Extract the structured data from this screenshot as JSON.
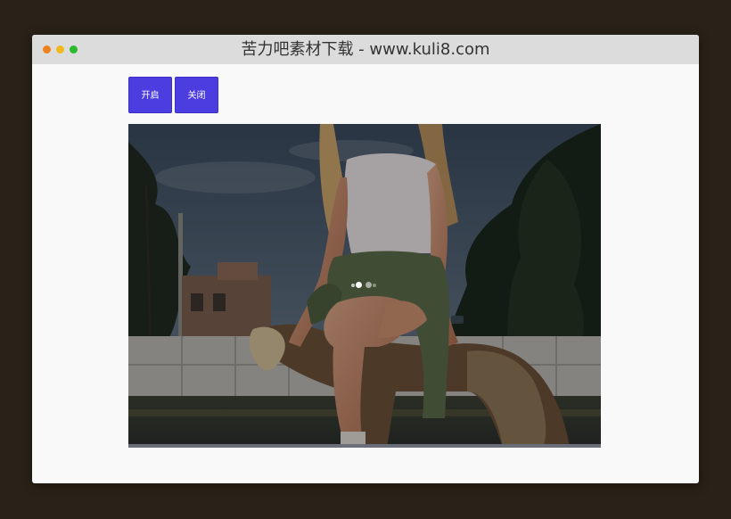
{
  "window": {
    "title": "苦力吧素材下载 - www.kuli8.com",
    "controls": {
      "close_color": "#f0821e",
      "minimize_color": "#f2b91d",
      "maximize_color": "#2cb92e"
    }
  },
  "toolbar": {
    "open_label": "开启",
    "close_label": "关闭",
    "button_color": "#4b3de0"
  },
  "viewer": {
    "image_subject": "woman-sitting-on-wooden-horse-photo",
    "loading_icon": "dots-spinner-icon",
    "overlay": "dimmed"
  }
}
